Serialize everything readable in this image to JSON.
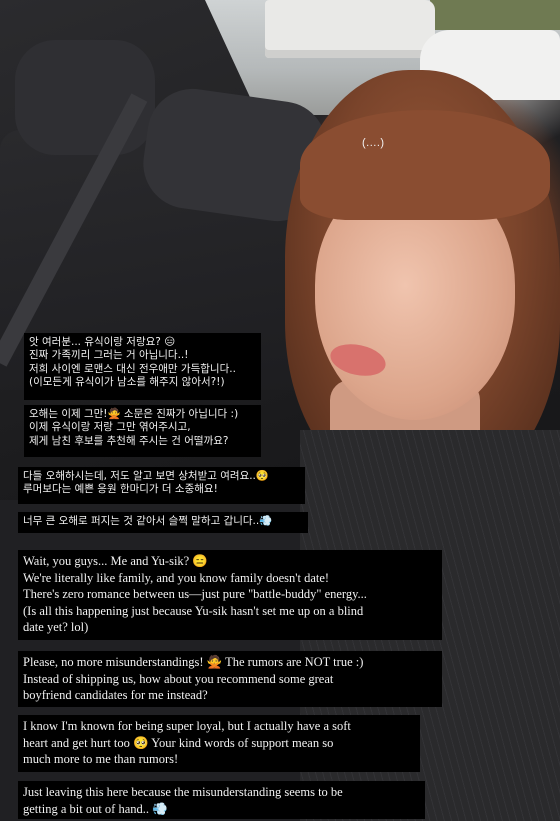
{
  "story": {
    "caption": "(....)",
    "messages_korean": [
      "앗 여러분... 유식이랑 저랑요? 😑\n진짜 가족끼리 그러는 거 아닙니다..!\n저희 사이엔 로맨스 대신 전우애만 가득합니다..\n(이모든게 유식이가 남소를 해주지 않아서?!)",
      "오해는 이제 그만!🙅 소문은 진짜가 아닙니다 :)\n이제 유식이랑 저랑 그만 엮어주시고,\n제게 남친 후보를 추천해 주시는 건 어떨까요?",
      "다들 오해하시는데, 저도 알고 보면 상처받고 여려요..🥺\n루머보다는 예쁜 응원 한마디가 더 소중해요!",
      "너무 큰 오해로 퍼지는 것 같아서 슬쩍 말하고 갑니다..💨"
    ],
    "messages_english": [
      "Wait, you guys... Me and Yu-sik? 😑\nWe're literally like family, and you know family doesn't date!\nThere's zero romance between us—just pure \"battle-buddy\" energy...\n(Is all this happening just because Yu-sik hasn't set me up on a blind\ndate yet? lol)",
      "Please, no more misunderstandings! 🙅 The rumors are NOT true :)\nInstead of shipping us, how about you recommend some great\nboyfriend candidates for me instead?",
      "I know I'm known for being super loyal, but I actually have a soft\nheart and get hurt too 🥺 Your kind words of support mean so\nmuch more to me than rumors!",
      "Just leaving this here because the misunderstanding seems to be\ngetting a bit out of hand.. 💨"
    ]
  }
}
